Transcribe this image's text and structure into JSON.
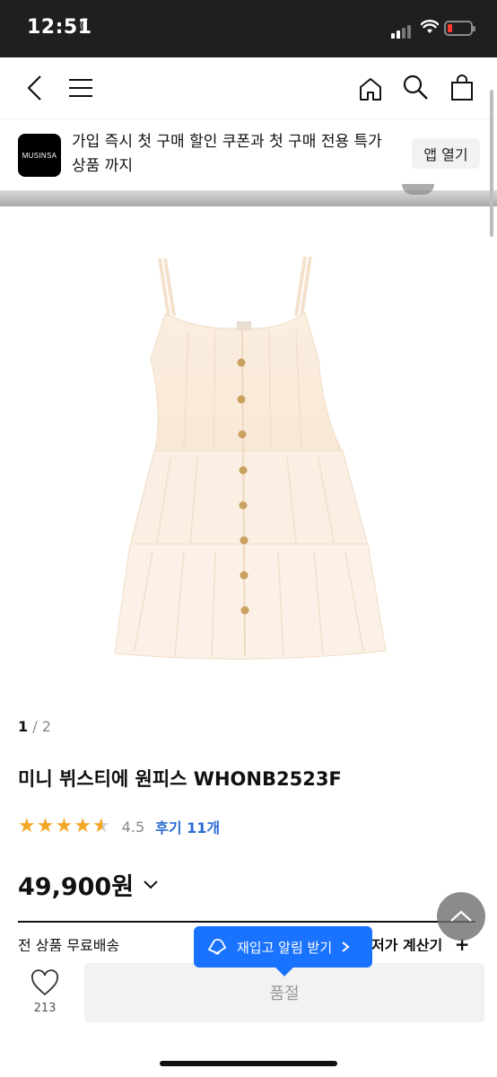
{
  "status_bar": {
    "time": "12:51"
  },
  "banner": {
    "logo_text": "MUSINSA",
    "text": "가입 즉시 첫 구매 할인 쿠폰과 첫 구매 전용 특가 상품 까지",
    "open_app_label": "앱 열기"
  },
  "product": {
    "pager_current": "1",
    "pager_total": " / 2",
    "name": "미니 뷔스티에 원피스 WHONB2523F",
    "rating_value": "4.5",
    "review_label": "후기 11개",
    "price": "49,900원",
    "shipping": "전 상품 무료배송",
    "calculator": "저가 계산기",
    "restock_tooltip": "재입고 알림 받기"
  },
  "bottom_bar": {
    "like_count": "213",
    "buy_label": "품절"
  },
  "colors": {
    "accent": "#1a73ff",
    "star": "#f5a623",
    "link": "#2a6ad3"
  }
}
